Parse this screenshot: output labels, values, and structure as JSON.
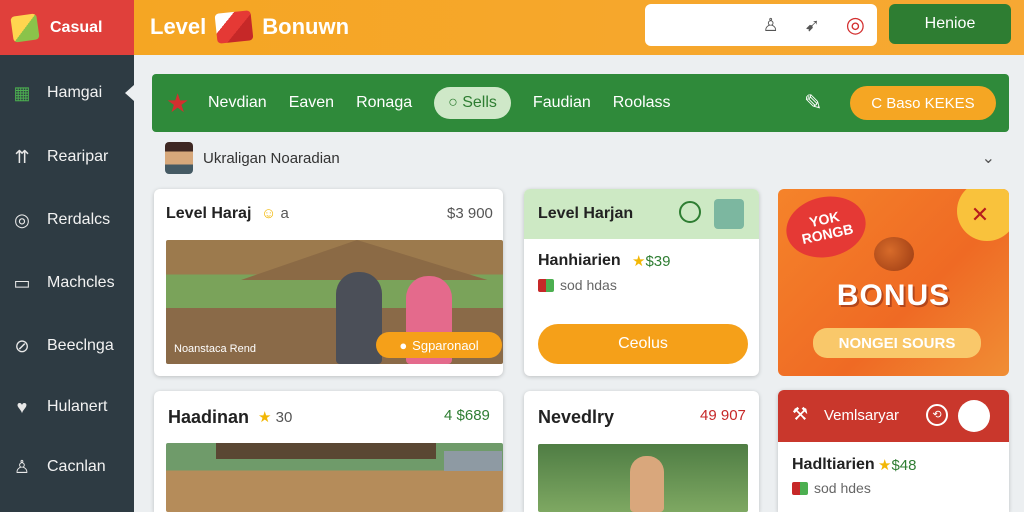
{
  "sidebar": {
    "brand": "Casual",
    "items": [
      {
        "label": "Hamgai",
        "icon": "box-icon"
      },
      {
        "label": "Rearipar",
        "icon": "users-icon"
      },
      {
        "label": "Rerdalcs",
        "icon": "target-icon"
      },
      {
        "label": "Machcles",
        "icon": "window-icon"
      },
      {
        "label": "Beeclnga",
        "icon": "compass-icon"
      },
      {
        "label": "Hulanert",
        "icon": "heart-icon"
      },
      {
        "label": "Cacnlan",
        "icon": "person-icon"
      }
    ]
  },
  "header": {
    "title_left": "Level",
    "title_right": "Bonuwn",
    "button": "Henioe",
    "tools": [
      "user-icon",
      "bird-icon",
      "target-icon"
    ]
  },
  "tabbar": {
    "tabs": [
      "Nevdian",
      "Eaven",
      "Ronaga",
      "Sells",
      "Faudian",
      "Roolass"
    ],
    "active": "Sells",
    "cta": "C Baso KEKES"
  },
  "user": {
    "name": "Ukraligan Noaradian"
  },
  "cards": {
    "c1": {
      "title": "Level Haraj",
      "meta": "a",
      "price": "$3 900",
      "photo_caption": "Noanstaca Rend",
      "photo_button": "Sgparonaol"
    },
    "c2": {
      "title": "Level Harjan",
      "line": "Hanhiarien",
      "price": "$39",
      "sub": "sod hdas",
      "button": "Ceolus"
    },
    "c3": {
      "badge": "YOK RONGB",
      "word": "BONUS",
      "button": "NONGEI SOURS"
    },
    "c4": {
      "title": "Haadinan",
      "meta": "30",
      "price": "4 $689"
    },
    "c5": {
      "title": "Nevedlry",
      "price": "49 907"
    },
    "c6": {
      "header": "Vemlsaryar",
      "line": "Hadltiarien",
      "price": "$48",
      "sub": "sod hdes"
    }
  },
  "colors": {
    "sidebar": "#2e3b43",
    "brand_red": "#e0403b",
    "header_orange": "#f5a623",
    "tab_green": "#2f8a3a",
    "cta_orange": "#f5a019"
  }
}
